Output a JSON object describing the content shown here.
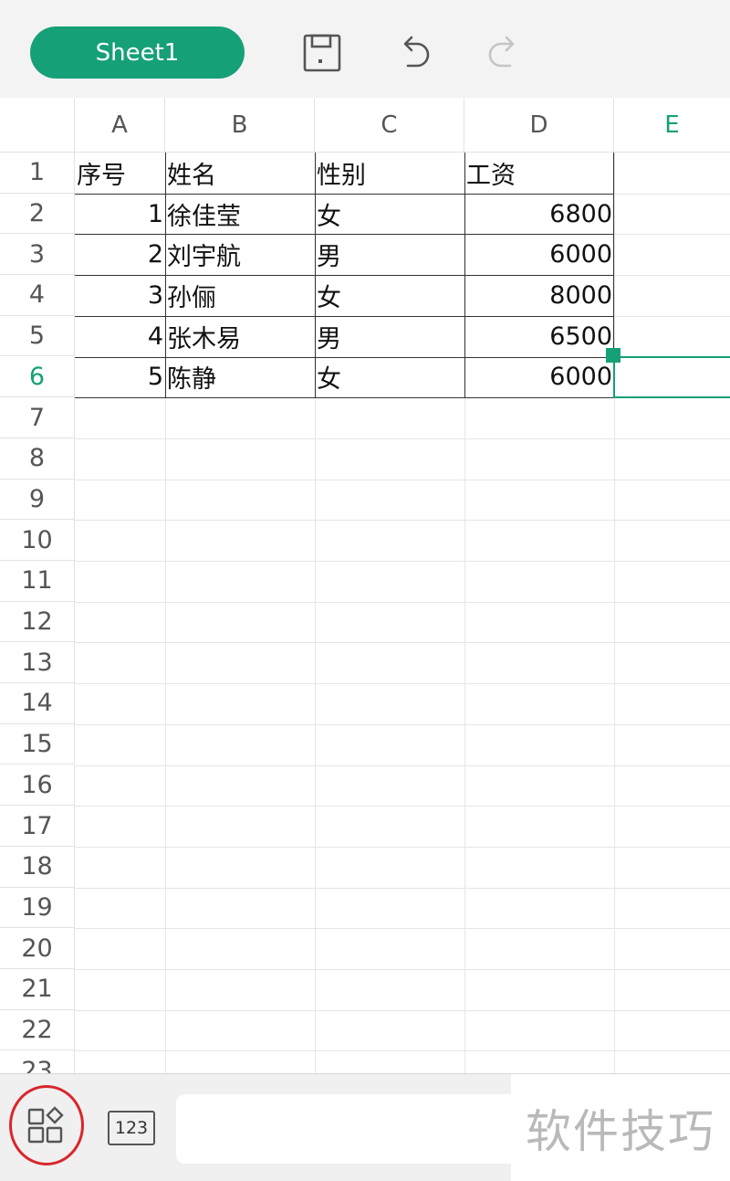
{
  "toolbar": {
    "sheet_tab_label": "Sheet1",
    "icons": [
      "save-icon",
      "undo-icon",
      "redo-icon"
    ],
    "accent_color": "#16a077"
  },
  "grid": {
    "columns": [
      "A",
      "B",
      "C",
      "D",
      "E"
    ],
    "active_column": "E",
    "rows": [
      "1",
      "2",
      "3",
      "4",
      "5",
      "6",
      "7",
      "8",
      "9",
      "10",
      "11",
      "12",
      "13",
      "14",
      "15",
      "16",
      "17",
      "18",
      "19",
      "20",
      "21",
      "22",
      "23"
    ],
    "active_row": "6",
    "cells": {
      "r1": {
        "a": "序号",
        "b": "姓名",
        "c": "性别",
        "d": "工资"
      },
      "r2": {
        "a": "1",
        "b": "徐佳莹",
        "c": "女",
        "d": "6800"
      },
      "r3": {
        "a": "2",
        "b": "刘宇航",
        "c": "男",
        "d": "6000"
      },
      "r4": {
        "a": "3",
        "b": "孙俪",
        "c": "女",
        "d": "8000"
      },
      "r5": {
        "a": "4",
        "b": "张木易",
        "c": "男",
        "d": "6500"
      },
      "r6": {
        "a": "5",
        "b": "陈静",
        "c": "女",
        "d": "6000"
      }
    },
    "selected_cell": "E6"
  },
  "bottom_bar": {
    "grid_button_icon": "apps-grid-icon",
    "number_keyboard_label": "123",
    "formula_input_value": "",
    "watermark": "软件技巧"
  }
}
